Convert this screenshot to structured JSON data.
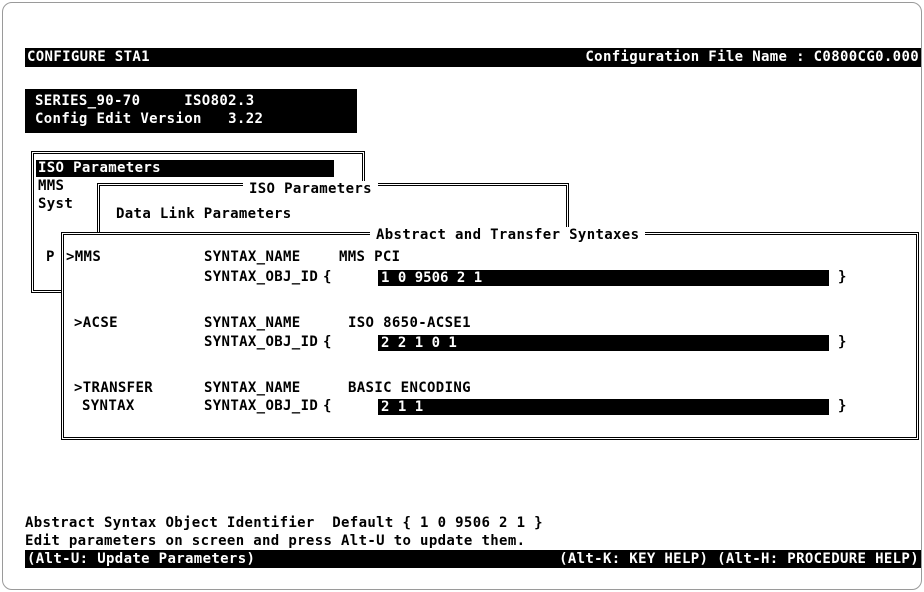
{
  "header": {
    "left": "CONFIGURE STA1",
    "right": "Configuration File Name : C0800CG0.000"
  },
  "info": {
    "line1": "SERIES_90-70     ISO802.3",
    "line2": "Config Edit Version   3.22"
  },
  "menu": {
    "items": [
      "ISO Parameters",
      "MMS",
      "Syst",
      "P"
    ]
  },
  "iso_params_title": "ISO Parameters",
  "datalink_label": "Data Link Parameters",
  "syntaxes": {
    "title": "Abstract and Transfer Syntaxes",
    "entries": [
      {
        "label": ">MMS",
        "label2": "",
        "name_key": "SYNTAX_NAME",
        "name_value": "MMS PCI",
        "id_key": "SYNTAX_OBJ_ID",
        "open_brace": "{",
        "id_value": "1 0 9506 2 1",
        "close_brace": "}"
      },
      {
        "label": ">ACSE",
        "label2": "",
        "name_key": "SYNTAX_NAME",
        "name_value": "ISO 8650-ACSE1",
        "id_key": "SYNTAX_OBJ_ID",
        "open_brace": "{",
        "id_value": "2 2 1 0 1",
        "close_brace": "}"
      },
      {
        "label": ">TRANSFER",
        "label2": "SYNTAX",
        "name_key": "SYNTAX_NAME",
        "name_value": "BASIC ENCODING",
        "id_key": "SYNTAX_OBJ_ID",
        "open_brace": "{",
        "id_value": "2 1 1",
        "close_brace": "}"
      }
    ]
  },
  "footer": {
    "help_line": "Abstract Syntax Object Identifier  Default { 1 0 9506 2 1 }",
    "instruction": "Edit parameters on screen and press Alt-U to update them.",
    "keys_left": "(Alt-U: Update Parameters)",
    "keys_right": "(Alt-K: KEY HELP) (Alt-H: PROCEDURE HELP)"
  }
}
